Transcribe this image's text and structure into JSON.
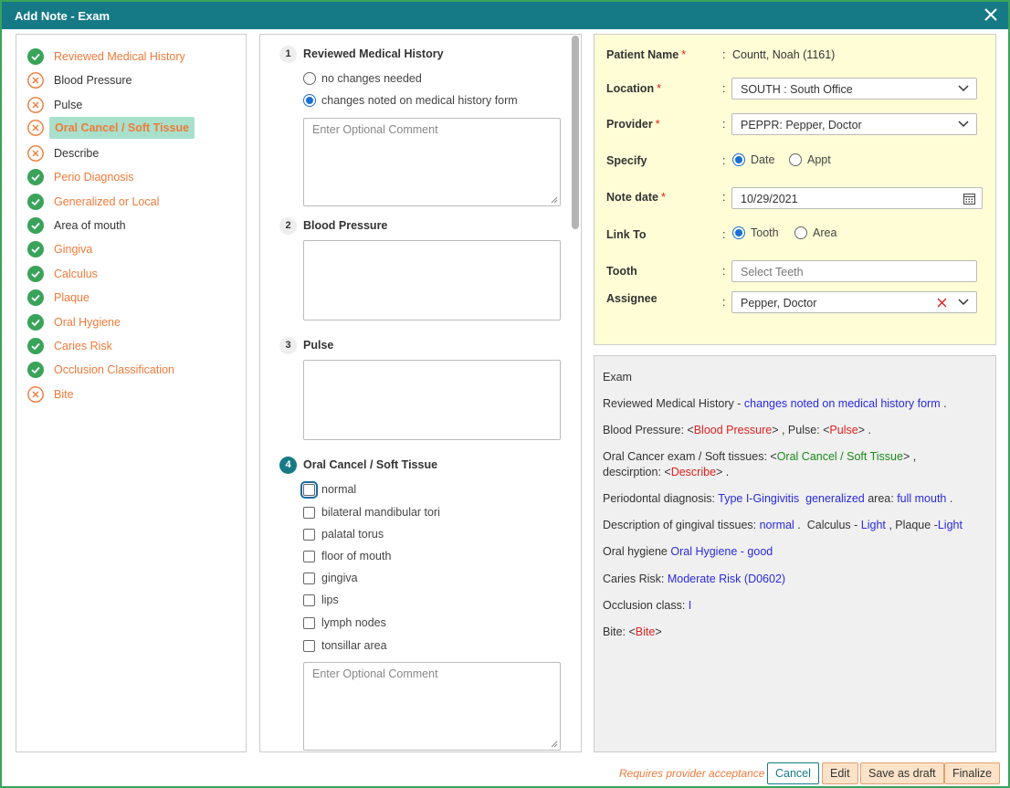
{
  "title": "Add Note - Exam",
  "steps": [
    {
      "label": "Reviewed Medical History",
      "status": "done",
      "color": "orange"
    },
    {
      "label": "Blood Pressure",
      "status": "missing",
      "color": "dark"
    },
    {
      "label": "Pulse",
      "status": "missing",
      "color": "dark"
    },
    {
      "label": "Oral Cancel / Soft Tissue",
      "status": "missing",
      "color": "active"
    },
    {
      "label": "Describe",
      "status": "missing",
      "color": "dark"
    },
    {
      "label": "Perio Diagnosis",
      "status": "done",
      "color": "orange"
    },
    {
      "label": "Generalized or Local",
      "status": "done",
      "color": "orange"
    },
    {
      "label": "Area of mouth",
      "status": "done",
      "color": "dark"
    },
    {
      "label": "Gingiva",
      "status": "done",
      "color": "orange"
    },
    {
      "label": "Calculus",
      "status": "done",
      "color": "orange"
    },
    {
      "label": "Plaque",
      "status": "done",
      "color": "orange"
    },
    {
      "label": "Oral Hygiene",
      "status": "done",
      "color": "orange"
    },
    {
      "label": "Caries Risk",
      "status": "done",
      "color": "orange"
    },
    {
      "label": "Occlusion Classification",
      "status": "done",
      "color": "orange"
    },
    {
      "label": "Bite",
      "status": "missing",
      "color": "orange"
    }
  ],
  "sections": {
    "s1": {
      "num": "1",
      "title": "Reviewed Medical History",
      "options": [
        "no changes needed",
        "changes noted on medical history form"
      ],
      "selected": 1,
      "comment_placeholder": "Enter Optional Comment"
    },
    "s2": {
      "num": "2",
      "title": "Blood Pressure"
    },
    "s3": {
      "num": "3",
      "title": "Pulse"
    },
    "s4": {
      "num": "4",
      "title": "Oral Cancel / Soft Tissue",
      "checkboxes": [
        "normal",
        "bilateral mandibular tori",
        "palatal torus",
        "floor of mouth",
        "gingiva",
        "lips",
        "lymph nodes",
        "tonsillar area"
      ],
      "comment_placeholder": "Enter Optional Comment"
    }
  },
  "form": {
    "patient_name_label": "Patient Name",
    "patient_name": "Countt, Noah (1161)",
    "location_label": "Location",
    "location": "SOUTH : South Office",
    "provider_label": "Provider",
    "provider": "PEPPR: Pepper, Doctor",
    "specify_label": "Specify",
    "specify_options": [
      "Date",
      "Appt"
    ],
    "note_date_label": "Note date",
    "note_date": "10/29/2021",
    "link_to_label": "Link To",
    "link_to_options": [
      "Tooth",
      "Area"
    ],
    "tooth_label": "Tooth",
    "tooth_placeholder": "Select Teeth",
    "assignee_label": "Assignee",
    "assignee": "Pepper, Doctor",
    "required_mark": "*",
    "colon": ":"
  },
  "preview": {
    "heading": "Exam",
    "l1_a": "Reviewed Medical History - ",
    "l1_b": "changes noted on medical history form",
    "l1_c": " .",
    "l2_a": "Blood Pressure: <",
    "l2_b": "Blood Pressure",
    "l2_c": "> , Pulse: <",
    "l2_d": "Pulse",
    "l2_e": "> .",
    "l3_a": "Oral Cancer exam / Soft tissues: <",
    "l3_b": "Oral Cancel / Soft Tissue",
    "l3_c": "> ,",
    "l3b_a": "descirption: <",
    "l3b_b": "Describe",
    "l3b_c": "> .",
    "l4_a": "Periodontal diagnosis: ",
    "l4_b": "Type I-Gingivitis  generalized",
    "l4_c": " area: ",
    "l4_d": "full mouth",
    "l4_e": " .",
    "l5_a": "Description of gingival tissues: ",
    "l5_b": "normal",
    "l5_c": " .  Calculus - ",
    "l5_d": "Light",
    "l5_e": " , Plaque -",
    "l5_f": "Light",
    "l6_a": "Oral hygiene ",
    "l6_b": "Oral Hygiene - good",
    "l7_a": "Caries Risk: ",
    "l7_b": "Moderate Risk (D0602)",
    "l8_a": "Occlusion class: ",
    "l8_b": "I",
    "l9_a": "Bite: <",
    "l9_b": "Bite",
    "l9_c": ">"
  },
  "footer": {
    "requires_text": "Requires provider acceptance",
    "cancel": "Cancel",
    "edit": "Edit",
    "save_draft": "Save as draft",
    "finalize": "Finalize"
  },
  "colors": {
    "header": "#167a86",
    "accent_orange": "#f07a3a",
    "done_green": "#3aa35a",
    "active_bg": "#a8e0cc",
    "form_bg": "#fffdd6"
  }
}
